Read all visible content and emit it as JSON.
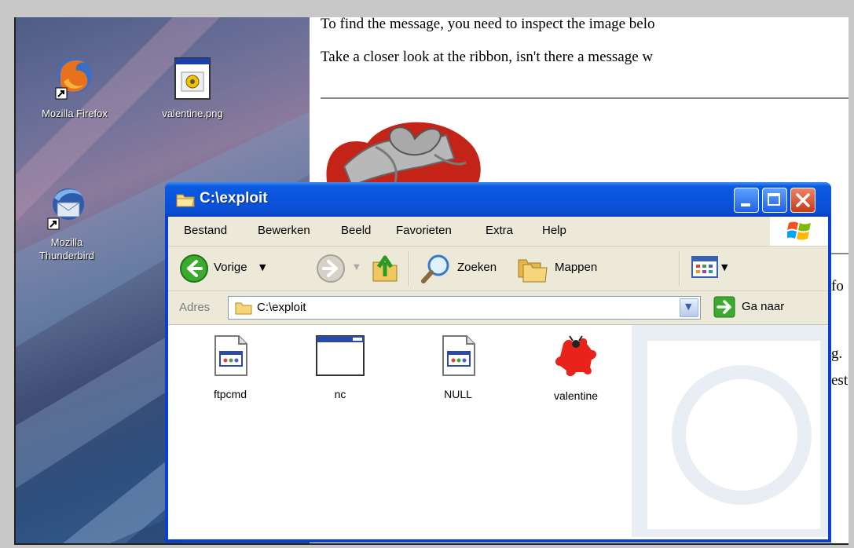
{
  "desktop": {
    "icons": [
      {
        "label": "Mozilla Firefox"
      },
      {
        "label": "valentine.png"
      },
      {
        "label": "Mozilla Thunderbird"
      }
    ]
  },
  "page": {
    "line1": "To find the message, you need to inspect the image belo",
    "line2": "Take a closer look at the ribbon, isn't there a message w",
    "right_fragments": [
      "fo",
      "g.",
      "est"
    ]
  },
  "window": {
    "title": "C:\\exploit",
    "menu": [
      "Bestand",
      "Bewerken",
      "Beeld",
      "Favorieten",
      "Extra",
      "Help"
    ],
    "toolbar": {
      "back_label": "Vorige",
      "search_label": "Zoeken",
      "folders_label": "Mappen"
    },
    "address": {
      "label": "Adres",
      "value": "C:\\exploit",
      "go_label": "Ga naar"
    },
    "files": [
      {
        "name": "ftpcmd"
      },
      {
        "name": "nc"
      },
      {
        "name": "NULL"
      },
      {
        "name": "valentine"
      }
    ]
  },
  "colors": {
    "titlebar": "#0a54dc",
    "menubar": "#ece9d8",
    "close_button": "#d8472a"
  }
}
